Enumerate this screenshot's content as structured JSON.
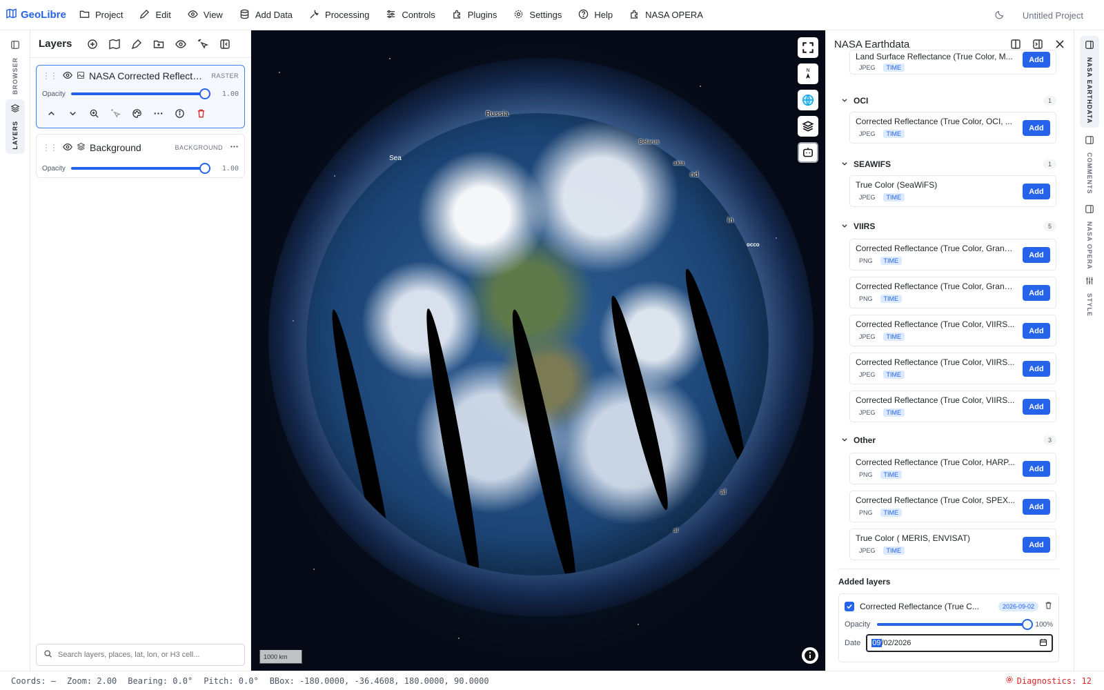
{
  "app": {
    "name": "GeoLibre",
    "project": "Untitled Project"
  },
  "menu": [
    "Project",
    "Edit",
    "View",
    "Add Data",
    "Processing",
    "Controls",
    "Plugins",
    "Settings",
    "Help",
    "NASA OPERA"
  ],
  "left_rail": {
    "browser": "BROWSER",
    "layers": "LAYERS"
  },
  "layers_panel": {
    "title": "Layers",
    "layers": [
      {
        "name": "NASA Corrected Reflectan...",
        "type": "RASTER",
        "opacity_label": "Opacity",
        "opacity": "1.00",
        "opacity_fraction": 1.0
      },
      {
        "name": "Background",
        "type": "BACKGROUND",
        "opacity_label": "Opacity",
        "opacity": "1.00",
        "opacity_fraction": 1.0
      }
    ],
    "search_placeholder": "Search layers, places, lat, lon, or H3 cell..."
  },
  "map": {
    "labels": [
      "Russia",
      "Sea",
      "Belarus",
      "akia",
      "nd",
      "in",
      "occo",
      "al",
      "al"
    ],
    "scale": "1000 km"
  },
  "earthdata": {
    "title": "NASA Earthdata",
    "top_item": {
      "name": "Land Surface Reflectance (True Color, M...",
      "format": "JPEG",
      "time": "TIME"
    },
    "groups": [
      {
        "name": "OCI",
        "count": "1",
        "items": [
          {
            "name": "Corrected Reflectance (True Color, OCI, ...",
            "format": "JPEG",
            "time": "TIME"
          }
        ]
      },
      {
        "name": "SEAWIFS",
        "count": "1",
        "items": [
          {
            "name": "True Color (SeaWiFS)",
            "format": "JPEG",
            "time": "TIME"
          }
        ]
      },
      {
        "name": "VIIRS",
        "count": "5",
        "items": [
          {
            "name": "Corrected Reflectance (True Color, Granu...",
            "format": "PNG",
            "time": "TIME"
          },
          {
            "name": "Corrected Reflectance (True Color, Granu...",
            "format": "PNG",
            "time": "TIME"
          },
          {
            "name": "Corrected Reflectance (True Color, VIIRS...",
            "format": "JPEG",
            "time": "TIME"
          },
          {
            "name": "Corrected Reflectance (True Color, VIIRS...",
            "format": "JPEG",
            "time": "TIME"
          },
          {
            "name": "Corrected Reflectance (True Color, VIIRS...",
            "format": "JPEG",
            "time": "TIME"
          }
        ]
      },
      {
        "name": "Other",
        "count": "3",
        "items": [
          {
            "name": "Corrected Reflectance (True Color, HARP...",
            "format": "PNG",
            "time": "TIME"
          },
          {
            "name": "Corrected Reflectance (True Color, SPEX...",
            "format": "PNG",
            "time": "TIME"
          },
          {
            "name": "True Color ( MERIS, ENVISAT)",
            "format": "JPEG",
            "time": "TIME"
          }
        ]
      }
    ],
    "add_label": "Add",
    "added": {
      "title": "Added layers",
      "name": "Corrected Reflectance (True C...",
      "date_pill": "2026-09-02",
      "opacity_label": "Opacity",
      "opacity": "100%",
      "opacity_fraction": 1.0,
      "date_label": "Date",
      "date_mm": "09",
      "date_rest": "/02/2026"
    }
  },
  "right_rail": [
    "NASA EARTHDATA",
    "COMMENTS",
    "NASA OPERA",
    "STYLE"
  ],
  "status": {
    "coords": "Coords: —",
    "zoom": "Zoom: 2.00",
    "bearing": "Bearing: 0.0°",
    "pitch": "Pitch: 0.0°",
    "bbox": "BBox: -180.0000, -36.4608, 180.0000, 90.0000",
    "diagnostics": "Diagnostics: 12"
  },
  "colors": {
    "accent": "#2563eb",
    "danger": "#dc2626"
  }
}
